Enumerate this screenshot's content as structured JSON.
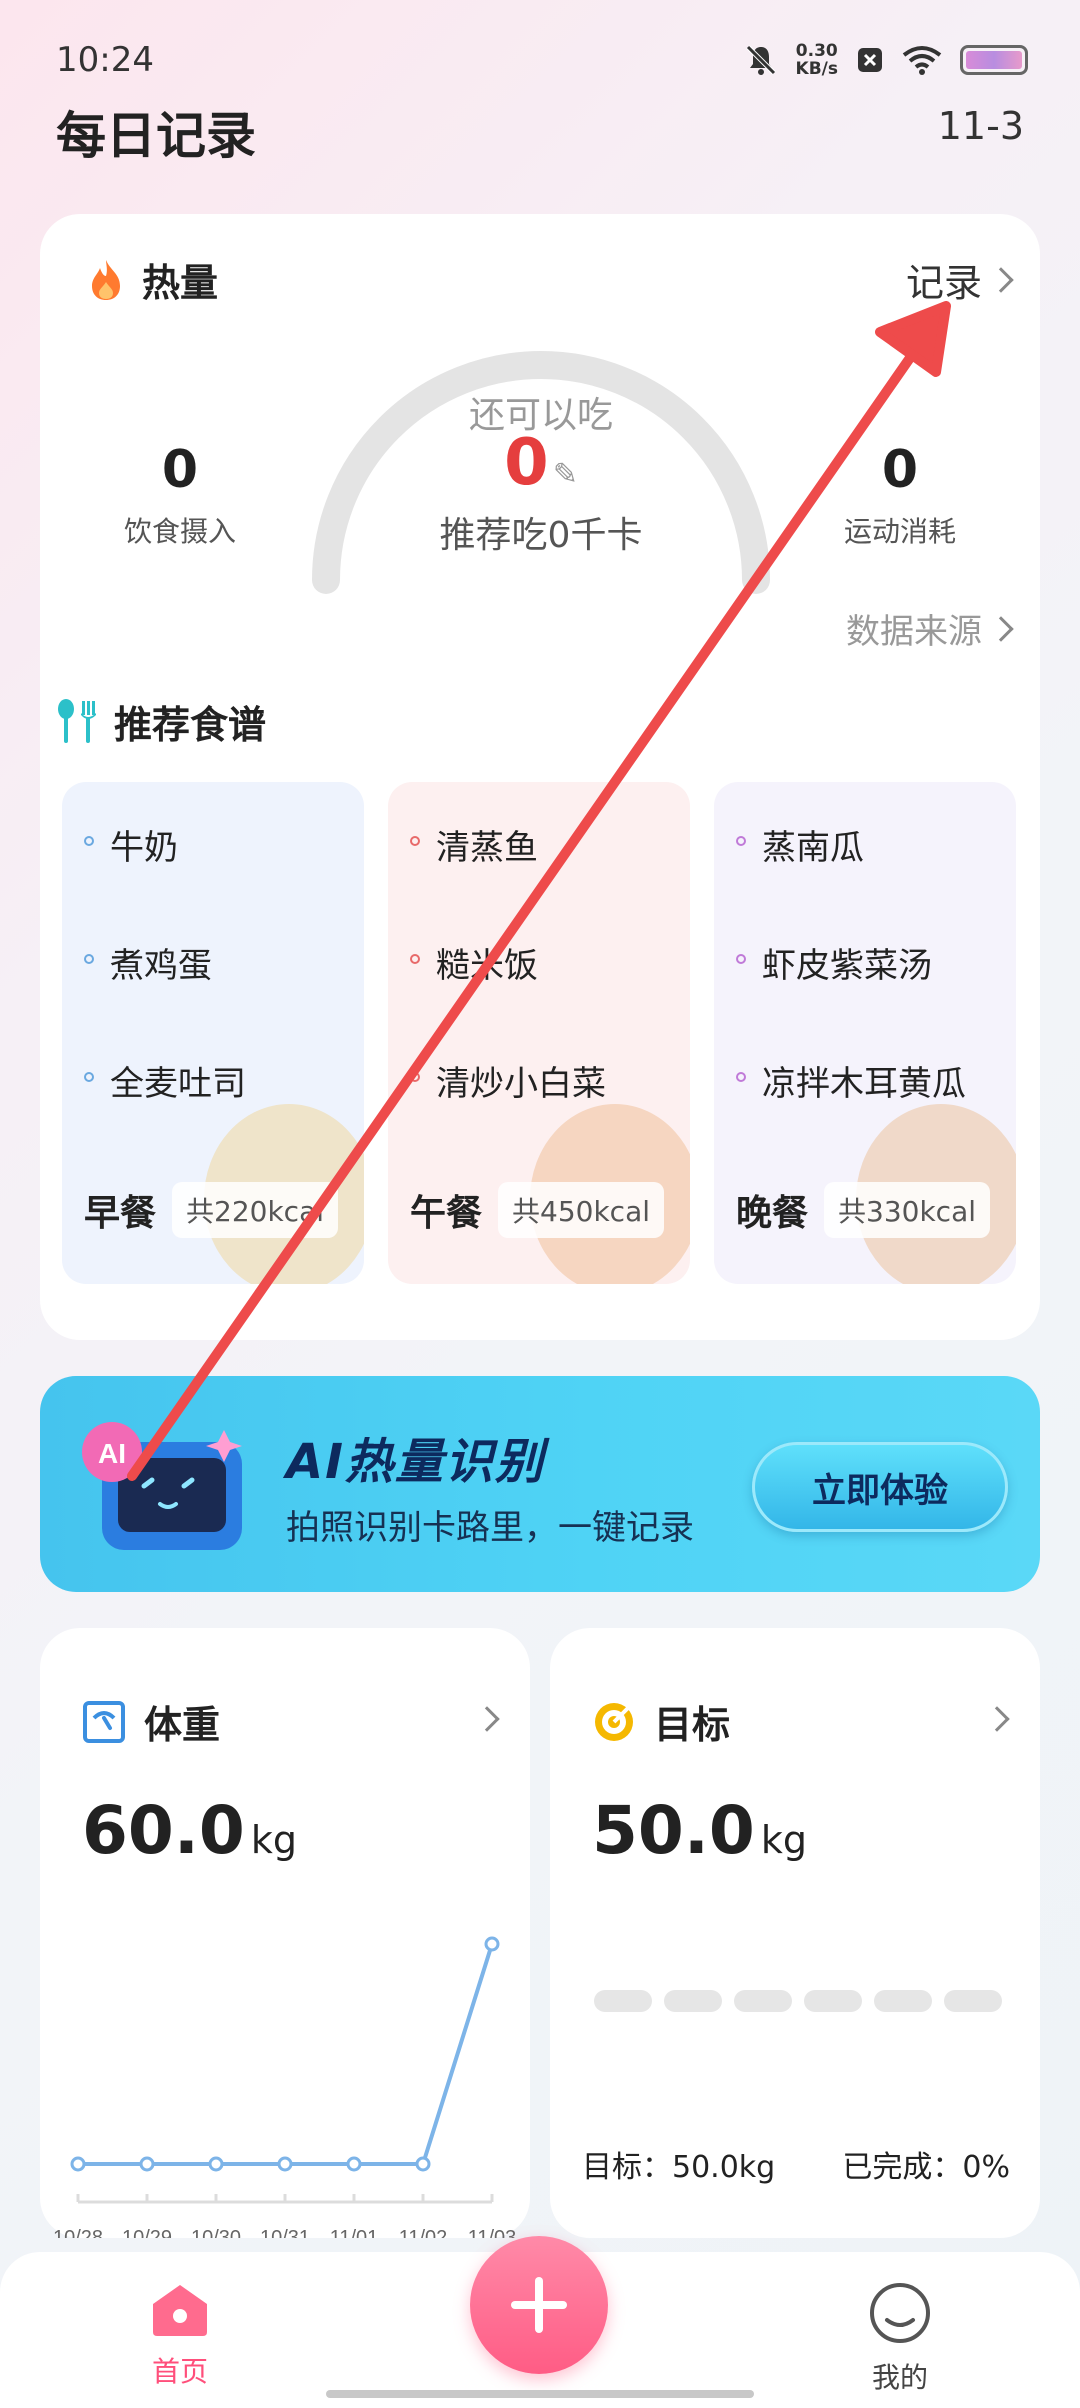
{
  "status_bar": {
    "time": "10:24",
    "net_speed_value": "0.30",
    "net_speed_unit": "KB/s"
  },
  "header": {
    "title": "每日记录",
    "date": "11-3"
  },
  "calorie": {
    "title": "热量",
    "record_label": "记录",
    "remaining_label": "还可以吃",
    "remaining_value": "0",
    "recommend_text": "推荐吃0千卡",
    "intake_value": "0",
    "intake_label": "饮食摄入",
    "burn_value": "0",
    "burn_label": "运动消耗",
    "data_source_label": "数据来源"
  },
  "recipes": {
    "title": "推荐食谱",
    "meals": [
      {
        "name": "早餐",
        "kcal": "共220kcal",
        "items": [
          "牛奶",
          "煮鸡蛋",
          "全麦吐司"
        ],
        "color": "#6aa8e0"
      },
      {
        "name": "午餐",
        "kcal": "共450kcal",
        "items": [
          "清蒸鱼",
          "糙米饭",
          "清炒小白菜"
        ],
        "color": "#e86a6a"
      },
      {
        "name": "晚餐",
        "kcal": "共330kcal",
        "items": [
          "蒸南瓜",
          "虾皮紫菜汤",
          "凉拌木耳黄瓜"
        ],
        "color": "#c07ad8"
      }
    ]
  },
  "ai_banner": {
    "title": "AI热量识别",
    "subtitle": "拍照识别卡路里，一键记录",
    "button": "立即体验",
    "badge": "AI"
  },
  "weight": {
    "title": "体重",
    "value": "60.0",
    "unit": "kg"
  },
  "goal": {
    "title": "目标",
    "value": "50.0",
    "unit": "kg",
    "target_text": "目标：50.0kg",
    "progress_text": "已完成：0%",
    "progress": 0
  },
  "chart_data": {
    "type": "line",
    "x": [
      "10/28",
      "10/29",
      "10/30",
      "10/31",
      "11/01",
      "11/02",
      "11/03"
    ],
    "series": [
      {
        "values": [
          0,
          0,
          0,
          0,
          0,
          0,
          60.0
        ]
      }
    ],
    "ylim": [
      0,
      60
    ],
    "grid": false
  },
  "nav": {
    "home": "首页",
    "mine": "我的"
  },
  "colors": {
    "accent_pink": "#ff5c85",
    "gauge_red": "#e53e3e",
    "ai_blue": "#4fd3f5",
    "chart_line": "#7db4e8"
  }
}
